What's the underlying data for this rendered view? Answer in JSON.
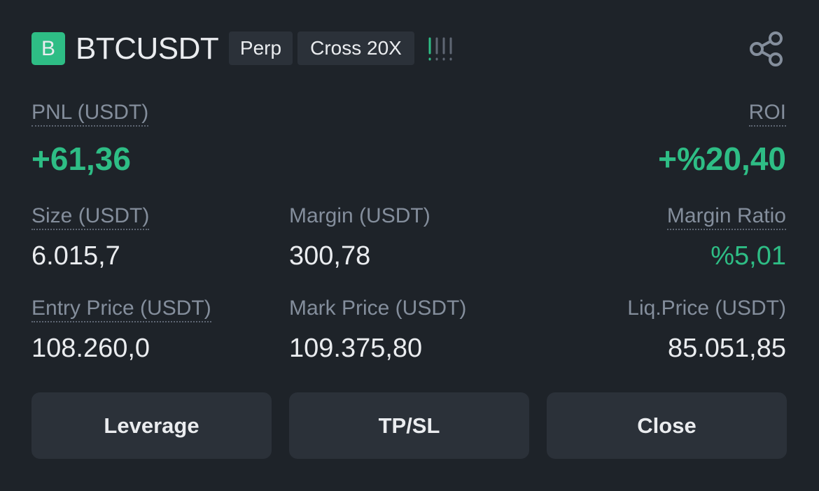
{
  "header": {
    "logo_letter": "B",
    "symbol": "BTCUSDT",
    "tag_type": "Perp",
    "tag_margin": "Cross 20X"
  },
  "pnl": {
    "label": "PNL (USDT)",
    "value": "+61,36"
  },
  "roi": {
    "label": "ROI",
    "value": "+%20,40"
  },
  "size": {
    "label": "Size (USDT)",
    "value": "6.015,7"
  },
  "margin": {
    "label": "Margin (USDT)",
    "value": "300,78"
  },
  "margin_ratio": {
    "label": "Margin Ratio",
    "value": "%5,01"
  },
  "entry_price": {
    "label": "Entry Price (USDT)",
    "value": "108.260,0"
  },
  "mark_price": {
    "label": "Mark Price (USDT)",
    "value": "109.375,80"
  },
  "liq_price": {
    "label": "Liq.Price (USDT)",
    "value": "85.051,85"
  },
  "buttons": {
    "leverage": "Leverage",
    "tpsl": "TP/SL",
    "close": "Close"
  },
  "colors": {
    "background": "#1e2329",
    "surface": "#2b3139",
    "positive": "#2ebd85",
    "text_primary": "#eaecef",
    "text_secondary": "#848e9c"
  },
  "icons": {
    "risk_level": "risk-bars-icon",
    "share": "share-icon"
  }
}
